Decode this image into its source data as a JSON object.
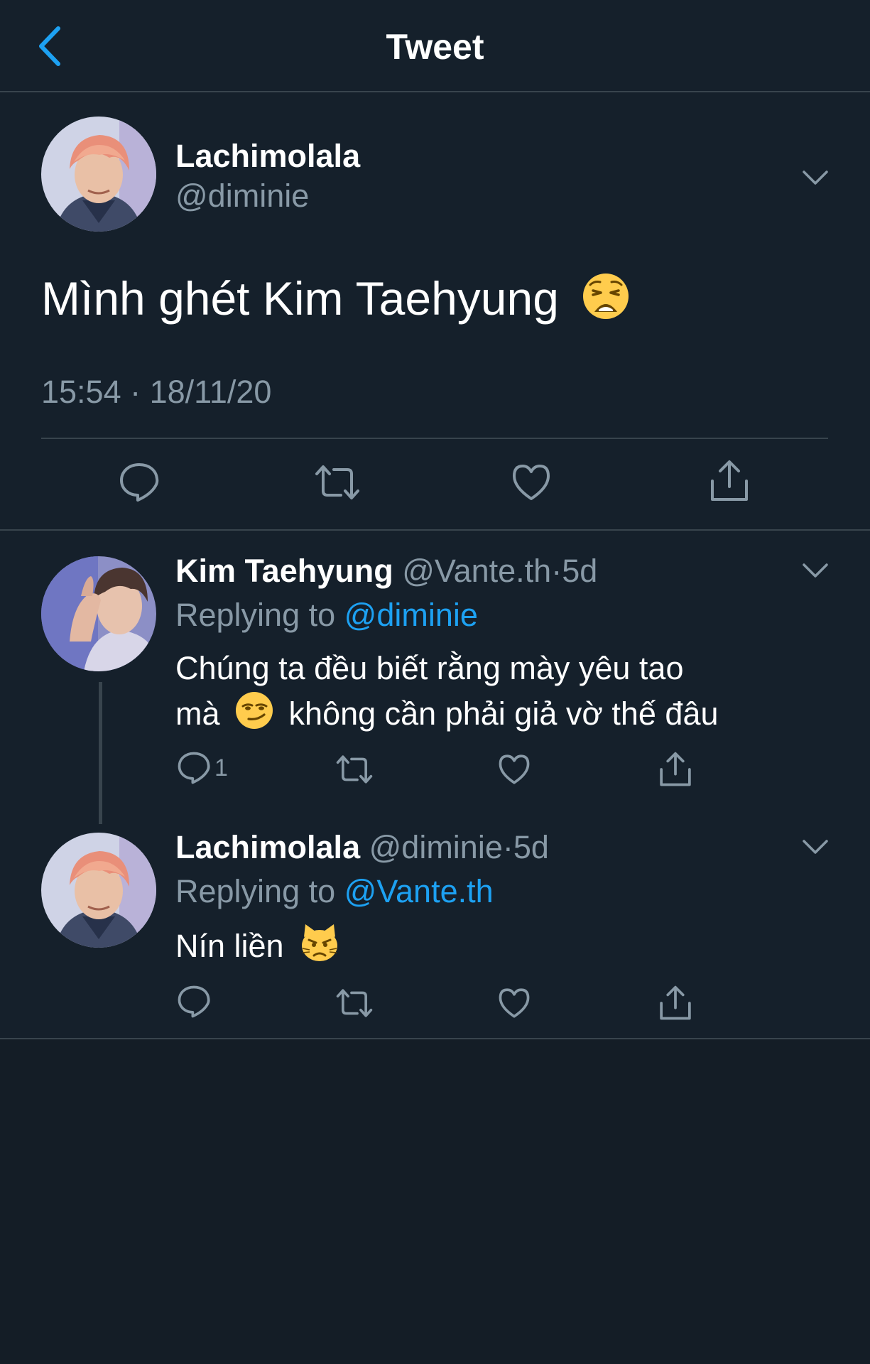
{
  "nav": {
    "title": "Tweet"
  },
  "main_tweet": {
    "name": "Lachimolala",
    "handle": "@diminie",
    "text": "Mình ghét Kim Taehyung",
    "emoji": "weary-face",
    "timestamp": "15:54 · 18/11/20"
  },
  "replies": [
    {
      "name": "Kim Taehyung",
      "handle": "@Vante.th",
      "dot": "·",
      "age": "5d",
      "replying_label": "Replying to",
      "replying_to": "@diminie",
      "line1": "Chúng ta đều biết rằng mày yêu tao",
      "line2_a": "mà",
      "emoji": "smirking-face",
      "line2_b": "không cần phải giả vờ thế đâu",
      "reply_count": "1"
    },
    {
      "name": "Lachimolala",
      "handle": "@diminie",
      "dot": "·",
      "age": "5d",
      "replying_label": "Replying to",
      "replying_to": "@Vante.th",
      "line1": "Nín liền",
      "emoji": "pouting-cat-face"
    }
  ],
  "colors": {
    "background": "#15202b",
    "accent": "#1da1f2",
    "muted": "#8899a6",
    "divider": "#38444d"
  }
}
